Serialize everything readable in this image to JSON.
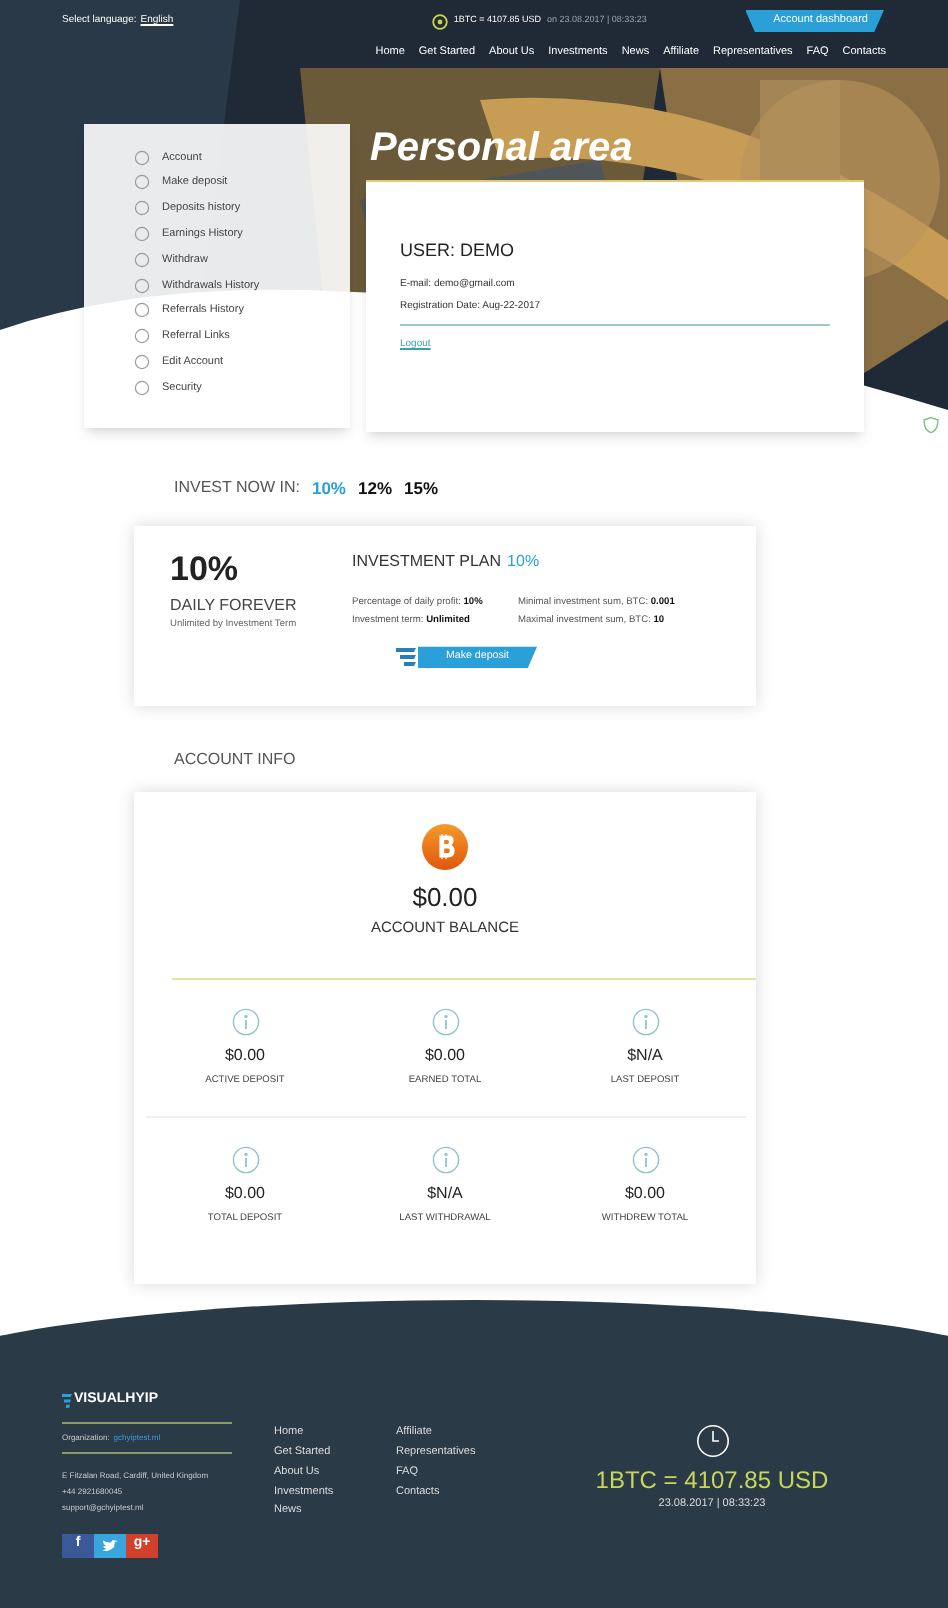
{
  "top_bar": {
    "language_label": "Select language:",
    "language": "English",
    "rate": "1BTC = 4107.85 USD",
    "rate_time": "on 23.08.2017 | 08:33:23",
    "dashboard_button": "Account dashboard"
  },
  "nav": [
    {
      "label": "Home"
    },
    {
      "label": "Get Started"
    },
    {
      "label": "About Us"
    },
    {
      "label": "Investments"
    },
    {
      "label": "News"
    },
    {
      "label": "Affiliate"
    },
    {
      "label": "Representatives"
    },
    {
      "label": "FAQ"
    },
    {
      "label": "Contacts"
    }
  ],
  "page_title": "Personal area",
  "sidebar": {
    "items": [
      {
        "label": "Account"
      },
      {
        "label": "Make deposit"
      },
      {
        "label": "Deposits history"
      },
      {
        "label": "Earnings History"
      },
      {
        "label": "Withdraw"
      },
      {
        "label": "Withdrawals History"
      },
      {
        "label": "Referrals History"
      },
      {
        "label": "Referral Links"
      },
      {
        "label": "Edit Account"
      },
      {
        "label": "Security"
      }
    ]
  },
  "user": {
    "title": "USER: DEMO",
    "email": "E-mail: demo@gmail.com",
    "registration": "Registration Date: Aug-22-2017",
    "logout": "Logout"
  },
  "invest": {
    "label": "INVEST NOW IN:",
    "options": [
      {
        "label": "10%",
        "selected": true
      },
      {
        "label": "12%",
        "selected": false
      },
      {
        "label": "15%",
        "selected": false
      }
    ]
  },
  "plan": {
    "big_rate": "10%",
    "subtitle": "DAILY FOREVER",
    "note": "Unlimited by Investment Term",
    "title": "INVESTMENT PLAN",
    "title_rate": "10%",
    "details": [
      {
        "text": "Percentage of daily profit: **10%**"
      },
      {
        "text": "Minimal investment sum, BTC: **0.001**"
      },
      {
        "text": "Investment term: **Unlimited**"
      },
      {
        "text": "Maximal investment sum, BTC: **10**"
      }
    ],
    "button": "Make deposit"
  },
  "account_info": {
    "heading": "ACCOUNT INFO",
    "balance": "$0.00",
    "balance_label": "ACCOUNT BALANCE",
    "stats": [
      {
        "value": "$0.00",
        "label": "ACTIVE DEPOSIT"
      },
      {
        "value": "$0.00",
        "label": "EARNED TOTAL"
      },
      {
        "value": "$N/A",
        "label": "LAST DEPOSIT"
      },
      {
        "value": "$0.00",
        "label": "TOTAL DEPOSIT"
      },
      {
        "value": "$N/A",
        "label": "LAST WITHDRAWAL"
      },
      {
        "value": "$0.00",
        "label": "WITHDREW TOTAL"
      }
    ]
  },
  "footer": {
    "brand": "VISUALHYIP",
    "organization_label": "Organization:",
    "organization": "gchyiptest.ml",
    "address": "E Fitzalan Road, Cardiff, United Kingdom",
    "phone": "+44 2921680045",
    "email": "support@gchyiptest.ml",
    "links_1": [
      {
        "label": "Home"
      },
      {
        "label": "Get Started"
      },
      {
        "label": "About Us"
      },
      {
        "label": "Investments"
      },
      {
        "label": "News"
      }
    ],
    "links_2": [
      {
        "label": "Affiliate"
      },
      {
        "label": "Representatives"
      },
      {
        "label": "FAQ"
      },
      {
        "label": "Contacts"
      }
    ],
    "rate": "1BTC = 4107.85 USD",
    "rate_time": "23.08.2017 | 08:33:23",
    "social": [
      {
        "kind": "facebook",
        "label": "f"
      },
      {
        "kind": "twitter"
      },
      {
        "kind": "google",
        "label": "g+"
      }
    ]
  }
}
